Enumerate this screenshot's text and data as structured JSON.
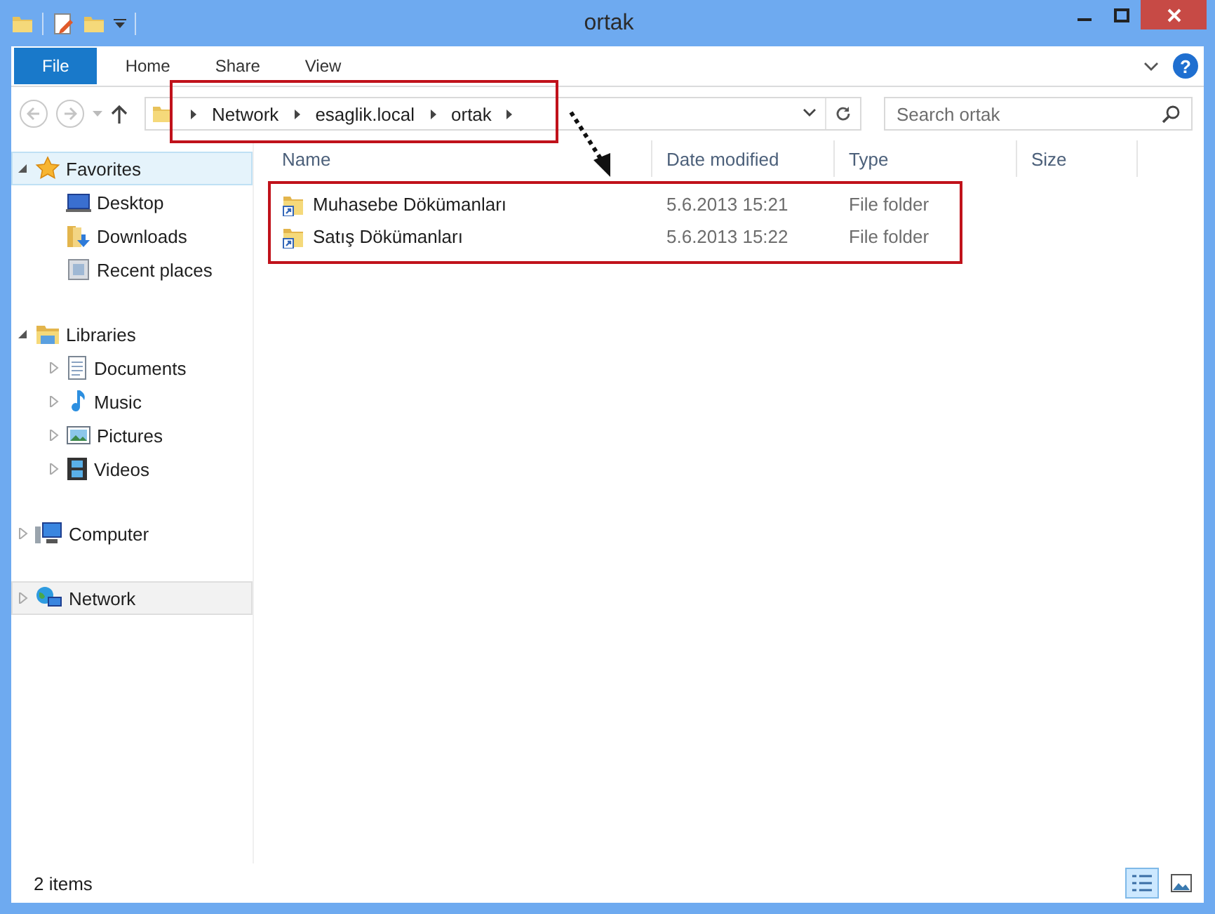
{
  "window": {
    "title": "ortak"
  },
  "ribbon": {
    "tabs": [
      {
        "label": "File",
        "kind": "file"
      },
      {
        "label": "Home",
        "kind": "tab"
      },
      {
        "label": "Share",
        "kind": "tab"
      },
      {
        "label": "View",
        "kind": "tab"
      }
    ],
    "help": "?"
  },
  "address": {
    "crumbs": [
      "Network",
      "esaglik.local",
      "ortak"
    ]
  },
  "search": {
    "placeholder": "Search ortak"
  },
  "sidebar": {
    "items": [
      {
        "label": "Favorites",
        "kind": "star",
        "expanded": true,
        "selected": true,
        "hovered": false,
        "children": [
          {
            "label": "Desktop",
            "kind": "desktop"
          },
          {
            "label": "Downloads",
            "kind": "downloads"
          },
          {
            "label": "Recent places",
            "kind": "recent"
          }
        ]
      },
      {
        "label": "Libraries",
        "kind": "libraries",
        "expanded": true,
        "selected": false,
        "hovered": false,
        "children": [
          {
            "label": "Documents",
            "kind": "documents",
            "expanded": false
          },
          {
            "label": "Music",
            "kind": "music",
            "expanded": false
          },
          {
            "label": "Pictures",
            "kind": "pictures",
            "expanded": false
          },
          {
            "label": "Videos",
            "kind": "videos",
            "expanded": false
          }
        ]
      },
      {
        "label": "Computer",
        "kind": "computer",
        "expanded": false,
        "selected": false,
        "hovered": false
      },
      {
        "label": "Network",
        "kind": "network",
        "expanded": false,
        "selected": false,
        "hovered": true
      }
    ]
  },
  "table": {
    "columns": [
      "Name",
      "Date modified",
      "Type",
      "Size"
    ],
    "rows": [
      {
        "name": "Muhasebe Dökümanları",
        "date": "5.6.2013 15:21",
        "type": "File folder"
      },
      {
        "name": "Satış Dökümanları",
        "date": "5.6.2013 15:22",
        "type": "File folder"
      }
    ]
  },
  "status_bar": {
    "text": "2 items"
  }
}
